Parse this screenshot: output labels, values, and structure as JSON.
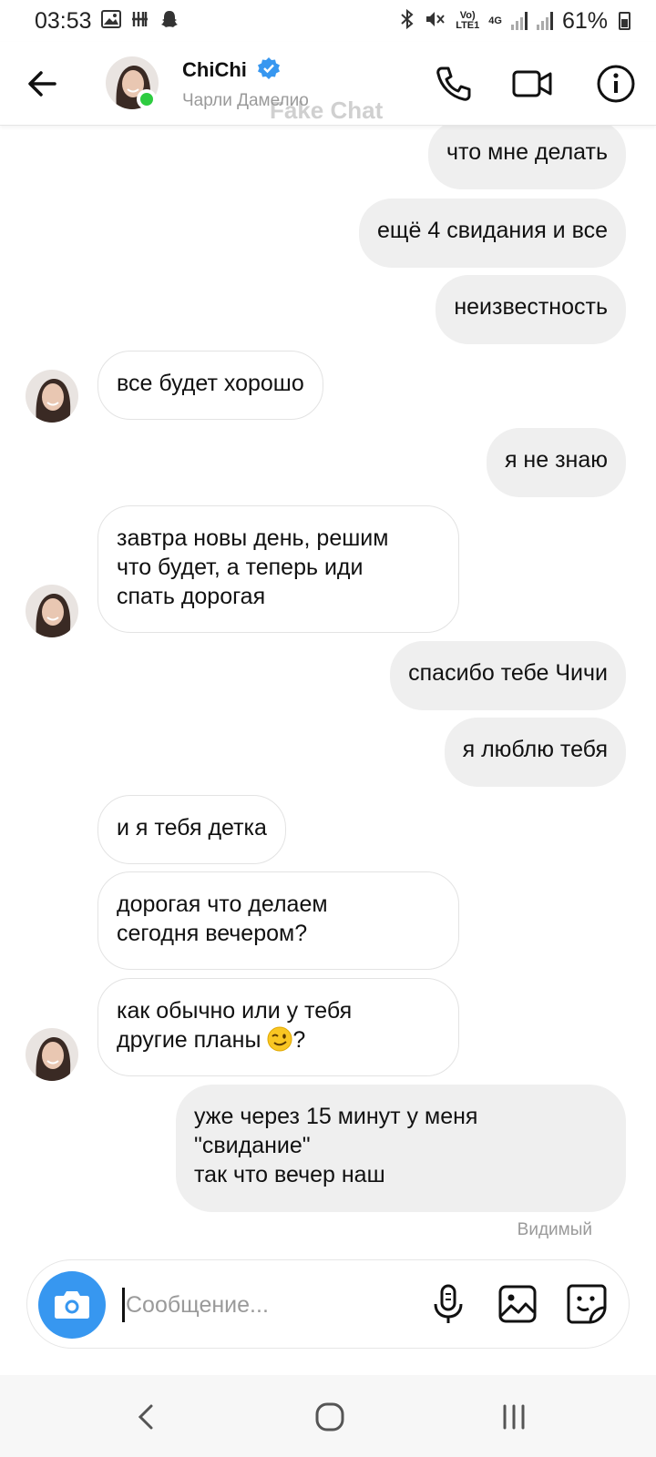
{
  "status_bar": {
    "time": "03:53",
    "network_top": "Vo)",
    "network_bottom": "LTE1",
    "net_type": "4G",
    "battery": "61%"
  },
  "header": {
    "contact_name": "ChiChi",
    "contact_subtitle": "Чарли Дамелио",
    "watermark": "Fake Chat",
    "online_color": "#2ecc40",
    "verified_color": "#3797f0"
  },
  "messages": [
    {
      "from": "me",
      "text": "что мне делать"
    },
    {
      "from": "me",
      "text": "ещё 4 свидания и все"
    },
    {
      "from": "me",
      "text": "неизвестность"
    },
    {
      "from": "them",
      "text": "все будет хорошо"
    },
    {
      "from": "me",
      "text": "я не знаю"
    },
    {
      "from": "them",
      "text": "завтра новы день, решим\nчто будет, а теперь иди\nспать дорогая"
    },
    {
      "from": "me",
      "text": "спасибо тебе Чичи"
    },
    {
      "from": "me",
      "text": "я люблю тебя"
    },
    {
      "from": "them",
      "text": "и я тебя детка"
    },
    {
      "from": "them",
      "text": "дорогая что делаем\nсегодня вечером?"
    },
    {
      "from": "them",
      "text_before_emoji": "как обычно или у тебя\nдругие планы ",
      "text_after_emoji": "?",
      "emoji": "winking-face"
    },
    {
      "from": "me",
      "text": "уже через 15 минут у меня\n\"свидание\"\nтак что вечер наш"
    }
  ],
  "seen_label": "Видимый",
  "composer": {
    "placeholder": "Сообщение...",
    "value": "",
    "camera_color": "#3797f0"
  },
  "icons": {
    "back": "arrow-left-icon",
    "call": "phone-icon",
    "video": "video-camera-icon",
    "info": "info-icon",
    "camera": "camera-icon",
    "mic": "microphone-icon",
    "gallery": "image-icon",
    "sticker": "sticker-icon"
  }
}
